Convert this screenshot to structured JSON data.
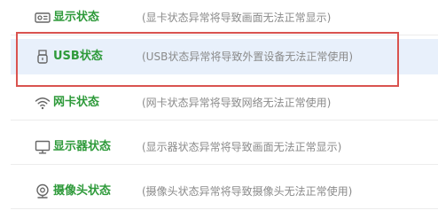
{
  "status_items": [
    {
      "icon": "gpu-card-icon",
      "label": "显示状态",
      "desc": "(显卡状态异常将导致画面无法正常显示)"
    },
    {
      "icon": "usb-icon",
      "label": "USB状态",
      "desc": "(USB状态异常将导致外置设备无法正常使用)"
    },
    {
      "icon": "wifi-icon",
      "label": "网卡状态",
      "desc": "(网卡状态异常将导致网络无法正常使用)"
    },
    {
      "icon": "monitor-icon",
      "label": "显示器状态",
      "desc": "(显示器状态异常将导致画面无法正常显示)"
    },
    {
      "icon": "webcam-icon",
      "label": "摄像头状态",
      "desc": "(摄像头状态异常将导致摄像头无法正常使用)"
    }
  ],
  "colors": {
    "label": "#2e9a3a",
    "desc": "#8a8a8a",
    "selected_bg": "#e8f0fb",
    "highlight_border": "#d9534f",
    "icon": "#666666"
  }
}
